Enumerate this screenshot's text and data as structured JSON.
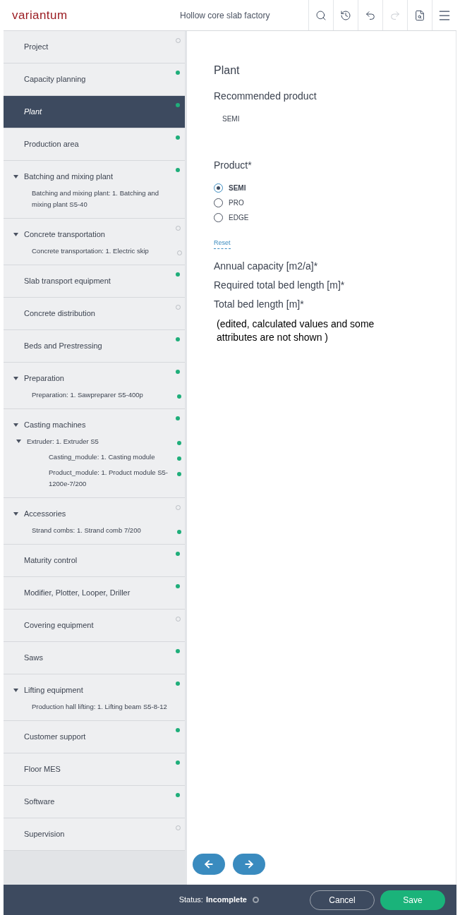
{
  "header": {
    "logo": "variantum",
    "title": "Hollow core slab factory",
    "toolbar": [
      {
        "kind": "search",
        "disabled": false
      },
      {
        "kind": "history",
        "disabled": false
      },
      {
        "kind": "undo",
        "disabled": false
      },
      {
        "kind": "redo",
        "disabled": true
      },
      {
        "kind": "preview",
        "disabled": false
      },
      {
        "kind": "menu",
        "disabled": false
      }
    ]
  },
  "sidebar": {
    "items": [
      {
        "label": "Project",
        "complete": false,
        "selected": false
      },
      {
        "label": "Capacity planning",
        "complete": true,
        "selected": false
      },
      {
        "label": "Plant",
        "complete": true,
        "selected": true
      },
      {
        "label": "Production area",
        "complete": true,
        "selected": false
      },
      {
        "label": "Batching and mixing plant",
        "complete": true,
        "selected": false,
        "expanded": true,
        "children": [
          {
            "label": "Batching and mixing plant: 1. Batching and mixing plant S5-40"
          }
        ]
      },
      {
        "label": "Concrete transportation",
        "complete": false,
        "selected": false,
        "expanded": true,
        "children": [
          {
            "label": "Concrete transportation: 1. Electric skip",
            "complete": false
          }
        ]
      },
      {
        "label": "Slab transport equipment",
        "complete": true,
        "selected": false
      },
      {
        "label": "Concrete distribution",
        "complete": false,
        "selected": false
      },
      {
        "label": "Beds and Prestressing",
        "complete": true,
        "selected": false
      },
      {
        "label": "Preparation",
        "complete": true,
        "selected": false,
        "expanded": true,
        "children": [
          {
            "label": "Preparation: 1. Sawpreparer S5-400p",
            "complete": true
          }
        ]
      },
      {
        "label": "Casting machines",
        "complete": true,
        "selected": false,
        "expanded": true,
        "children": [
          {
            "label": "Extruder: 1. Extruder S5",
            "complete": true,
            "expanded": true,
            "children": [
              {
                "label": "Casting_module: 1. Casting module",
                "complete": true
              },
              {
                "label": "Product_module: 1. Product module S5-1200e-7/200",
                "complete": true
              }
            ]
          }
        ]
      },
      {
        "label": "Accessories",
        "complete": false,
        "selected": false,
        "expanded": true,
        "children": [
          {
            "label": "Strand combs: 1. Strand comb 7/200",
            "complete": true
          }
        ]
      },
      {
        "label": "Maturity control",
        "complete": true,
        "selected": false
      },
      {
        "label": "Modifier, Plotter, Looper, Driller",
        "complete": true,
        "selected": false
      },
      {
        "label": "Covering equipment",
        "complete": false,
        "selected": false
      },
      {
        "label": "Saws",
        "complete": true,
        "selected": false
      },
      {
        "label": "Lifting equipment",
        "complete": true,
        "selected": false,
        "expanded": true,
        "children": [
          {
            "label": "Production hall lifting: 1. Lifting beam S5-8-12"
          }
        ]
      },
      {
        "label": "Customer support",
        "complete": true,
        "selected": false
      },
      {
        "label": "Floor MES",
        "complete": true,
        "selected": false
      },
      {
        "label": "Software",
        "complete": true,
        "selected": false
      },
      {
        "label": "Supervision",
        "complete": false,
        "selected": false
      }
    ]
  },
  "main": {
    "title": "Plant",
    "recommended_label": "Recommended product",
    "recommended_value": "SEMI",
    "product_label": "Product*",
    "options": [
      {
        "label": "SEMI",
        "selected": true
      },
      {
        "label": "PRO",
        "selected": false
      },
      {
        "label": "EDGE",
        "selected": false
      }
    ],
    "reset": "Reset",
    "fields": [
      "Annual capacity [m2/a]*",
      "Required total bed length [m]*",
      "Total bed length [m]*"
    ],
    "note": "(edited, calculated values and some attributes are not shown )"
  },
  "footer": {
    "status_label": "Status:",
    "status_value": "Incomplete",
    "status_complete": false,
    "cancel": "Cancel",
    "save": "Save"
  }
}
